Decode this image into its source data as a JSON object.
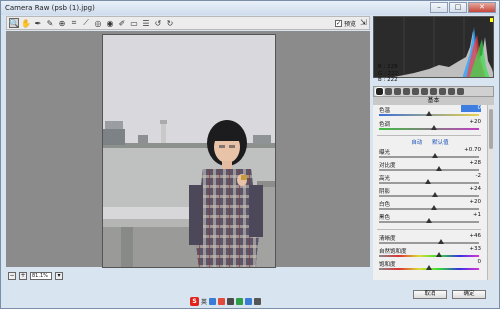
{
  "window": {
    "title": "Camera Raw (psb (1).jpg)",
    "controls": [
      "minimize",
      "maximize",
      "close"
    ]
  },
  "toolbar": {
    "tools": [
      "zoom-icon",
      "hand-icon",
      "white-balance-icon",
      "color-sampler-icon",
      "targeted-adjust-icon",
      "crop-icon",
      "straighten-icon",
      "spot-removal-icon",
      "red-eye-icon",
      "adjustment-brush-icon",
      "graduated-filter-icon",
      "preferences-icon",
      "rotate-ccw-icon",
      "rotate-cw-icon"
    ],
    "preview_label": "预览",
    "preview_checked": true
  },
  "status": {
    "zoom_value": "81.1%"
  },
  "histogram": {
    "r": "R :  228",
    "g": "G :  222",
    "b": "B :  222"
  },
  "panel": {
    "section_title": "基本",
    "auto": "自动",
    "default": "默认值",
    "sliders": [
      {
        "label": "色温",
        "value": "0",
        "pos": 0.5,
        "highlight": true
      },
      {
        "label": "色调",
        "value": "+20",
        "pos": 0.55
      },
      {
        "label": "曝光",
        "value": "+0.70",
        "pos": 0.56
      },
      {
        "label": "对比度",
        "value": "+28",
        "pos": 0.6
      },
      {
        "label": "高光",
        "value": "-2",
        "pos": 0.49
      },
      {
        "label": "阴影",
        "value": "+24",
        "pos": 0.56
      },
      {
        "label": "白色",
        "value": "+20",
        "pos": 0.55
      },
      {
        "label": "黑色",
        "value": "+1",
        "pos": 0.5
      },
      {
        "label": "清晰度",
        "value": "+46",
        "pos": 0.62
      },
      {
        "label": "自然饱和度",
        "value": "+33",
        "pos": 0.6
      },
      {
        "label": "饱和度",
        "value": "0",
        "pos": 0.5
      }
    ]
  },
  "buttons": {
    "cancel": "取消",
    "ok": "确定"
  },
  "ime": {
    "lang": "英"
  }
}
